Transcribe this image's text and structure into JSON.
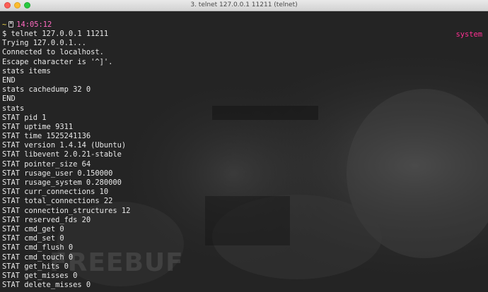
{
  "window": {
    "title": "3. telnet 127.0.0.1 11211 (telnet)"
  },
  "prompt": {
    "tilde": "~",
    "time": "14:05:12",
    "right_prompt": "system",
    "icon": "disk-icon"
  },
  "lines": [
    "$ telnet 127.0.0.1 11211",
    "Trying 127.0.0.1...",
    "Connected to localhost.",
    "Escape character is '^]'.",
    "stats items",
    "END",
    "stats cachedump 32 0",
    "END",
    "stats",
    "STAT pid 1",
    "STAT uptime 9311",
    "STAT time 1525241136",
    "STAT version 1.4.14 (Ubuntu)",
    "STAT libevent 2.0.21-stable",
    "STAT pointer_size 64",
    "STAT rusage_user 0.150000",
    "STAT rusage_system 0.280000",
    "STAT curr_connections 10",
    "STAT total_connections 22",
    "STAT connection_structures 12",
    "STAT reserved_fds 20",
    "STAT cmd_get 0",
    "STAT cmd_set 0",
    "STAT cmd_flush 0",
    "STAT cmd_touch 0",
    "STAT get_hits 0",
    "STAT get_misses 0",
    "STAT delete_misses 0"
  ],
  "watermark": "FREEBUF",
  "colors": {
    "prompt_tilde": "#e9d34a",
    "clock": "#ff6ac1",
    "right_prompt": "#ff2f92",
    "text": "#e9e9e9"
  }
}
